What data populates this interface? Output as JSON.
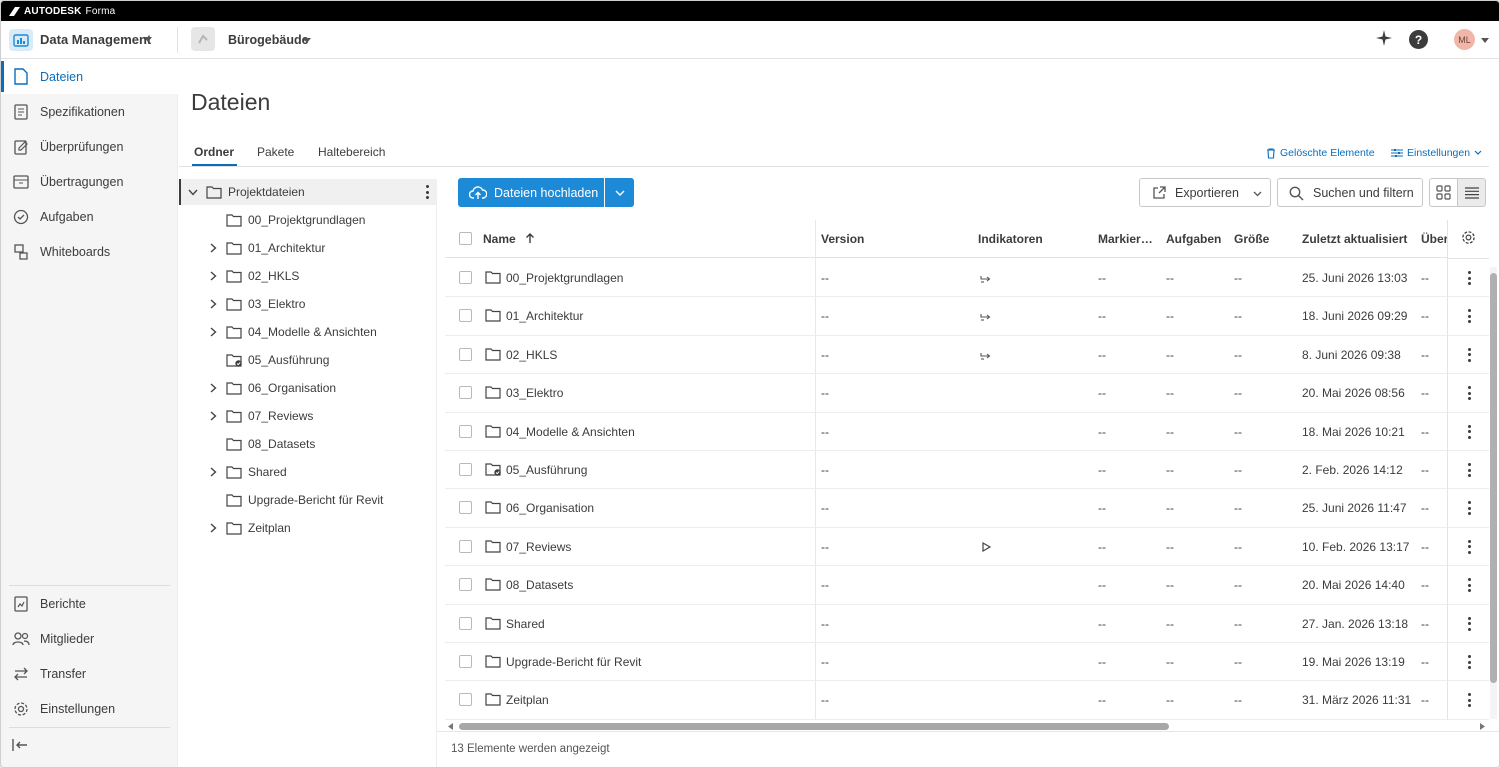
{
  "brand": {
    "company": "AUTODESK",
    "product": "Forma"
  },
  "topbar": {
    "app_name": "Data Management",
    "project_name": "Bürogebäude",
    "avatar_initials": "ML",
    "help_label": "?"
  },
  "sidebar": {
    "items": [
      {
        "label": "Dateien",
        "icon": "file-icon",
        "active": true
      },
      {
        "label": "Spezifikationen",
        "icon": "spec-icon"
      },
      {
        "label": "Überprüfungen",
        "icon": "review-icon"
      },
      {
        "label": "Übertragungen",
        "icon": "transmittal-icon"
      },
      {
        "label": "Aufgaben",
        "icon": "task-check-icon"
      },
      {
        "label": "Whiteboards",
        "icon": "whiteboard-icon"
      }
    ],
    "bottom_items": [
      {
        "label": "Berichte",
        "icon": "report-icon"
      },
      {
        "label": "Mitglieder",
        "icon": "members-icon"
      },
      {
        "label": "Transfer",
        "icon": "transfer-icon"
      },
      {
        "label": "Einstellungen",
        "icon": "settings-icon"
      }
    ]
  },
  "main": {
    "title": "Dateien",
    "tabs": [
      {
        "label": "Ordner",
        "active": true
      },
      {
        "label": "Pakete"
      },
      {
        "label": "Haltebereich"
      }
    ],
    "deleted_items_link": "Gelöschte Elemente",
    "settings_link": "Einstellungen"
  },
  "tree": {
    "root": "Projektdateien",
    "items": [
      {
        "label": "00_Projektgrundlagen",
        "expandable": false
      },
      {
        "label": "01_Architektur",
        "expandable": true
      },
      {
        "label": "02_HKLS",
        "expandable": true
      },
      {
        "label": "03_Elektro",
        "expandable": true
      },
      {
        "label": "04_Modelle & Ansichten",
        "expandable": true
      },
      {
        "label": "05_Ausführung",
        "expandable": false,
        "special": true
      },
      {
        "label": "06_Organisation",
        "expandable": true
      },
      {
        "label": "07_Reviews",
        "expandable": true
      },
      {
        "label": "08_Datasets",
        "expandable": false
      },
      {
        "label": "Shared",
        "expandable": true
      },
      {
        "label": "Upgrade-Bericht für Revit",
        "expandable": false
      },
      {
        "label": "Zeitplan",
        "expandable": true
      }
    ]
  },
  "toolbar": {
    "upload_label": "Dateien hochladen",
    "export_label": "Exportieren",
    "search_label": "Suchen und filtern"
  },
  "table": {
    "columns": [
      "Name",
      "Version",
      "Indikatoren",
      "Markier…",
      "Aufgaben",
      "Größe",
      "Zuletzt aktualisiert",
      "Über"
    ],
    "rows": [
      {
        "name": "00_Projektgrundlagen",
        "version": "--",
        "indicator": "link",
        "mark": "--",
        "tasks": "--",
        "size": "--",
        "updated": "25. Juni 2026 13:03",
        "by": "--"
      },
      {
        "name": "01_Architektur",
        "version": "--",
        "indicator": "link",
        "mark": "--",
        "tasks": "--",
        "size": "--",
        "updated": "18. Juni 2026 09:29",
        "by": "--"
      },
      {
        "name": "02_HKLS",
        "version": "--",
        "indicator": "link",
        "mark": "--",
        "tasks": "--",
        "size": "--",
        "updated": "8. Juni 2026 09:38",
        "by": "--"
      },
      {
        "name": "03_Elektro",
        "version": "--",
        "indicator": "",
        "mark": "--",
        "tasks": "--",
        "size": "--",
        "updated": "20. Mai 2026 08:56",
        "by": "--"
      },
      {
        "name": "04_Modelle & Ansichten",
        "version": "--",
        "indicator": "",
        "mark": "--",
        "tasks": "--",
        "size": "--",
        "updated": "18. Mai 2026 10:21",
        "by": "--"
      },
      {
        "name": "05_Ausführung",
        "version": "--",
        "indicator": "",
        "mark": "--",
        "tasks": "--",
        "size": "--",
        "updated": "2. Feb. 2026 14:12",
        "by": "--",
        "special": true
      },
      {
        "name": "06_Organisation",
        "version": "--",
        "indicator": "",
        "mark": "--",
        "tasks": "--",
        "size": "--",
        "updated": "25. Juni 2026 11:47",
        "by": "--"
      },
      {
        "name": "07_Reviews",
        "version": "--",
        "indicator": "play",
        "mark": "--",
        "tasks": "--",
        "size": "--",
        "updated": "10. Feb. 2026 13:17",
        "by": "--"
      },
      {
        "name": "08_Datasets",
        "version": "--",
        "indicator": "",
        "mark": "--",
        "tasks": "--",
        "size": "--",
        "updated": "20. Mai 2026 14:40",
        "by": "--"
      },
      {
        "name": "Shared",
        "version": "--",
        "indicator": "",
        "mark": "--",
        "tasks": "--",
        "size": "--",
        "updated": "27. Jan. 2026 13:18",
        "by": "--"
      },
      {
        "name": "Upgrade-Bericht für Revit",
        "version": "--",
        "indicator": "",
        "mark": "--",
        "tasks": "--",
        "size": "--",
        "updated": "19. Mai 2026 13:19",
        "by": "--"
      },
      {
        "name": "Zeitplan",
        "version": "--",
        "indicator": "",
        "mark": "--",
        "tasks": "--",
        "size": "--",
        "updated": "31. März 2026 11:31",
        "by": "--"
      }
    ],
    "footer": "13 Elemente werden angezeigt"
  },
  "colors": {
    "accent": "#0a6ebd",
    "primary_button": "#1d8ad8"
  }
}
